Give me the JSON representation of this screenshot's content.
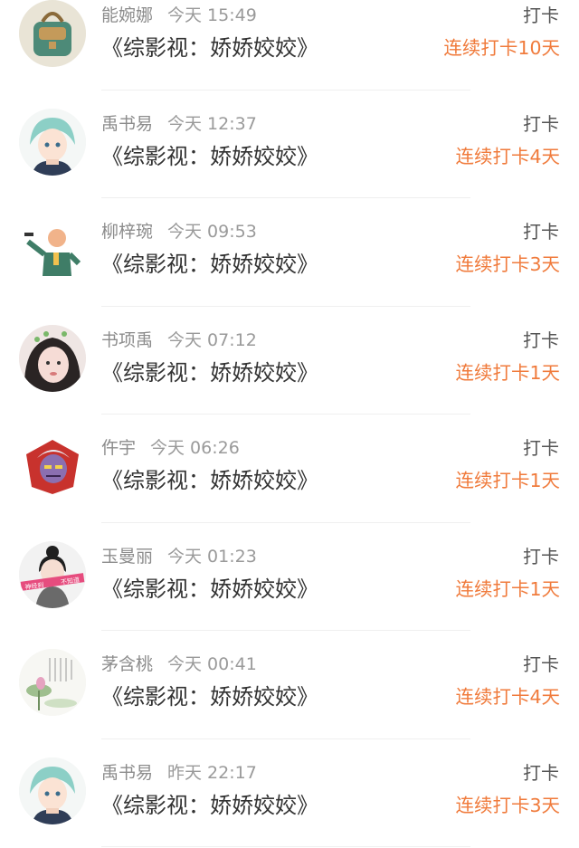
{
  "entries": [
    {
      "user": "能婉娜",
      "time": "今天 15:49",
      "book": "《综影视：娇娇姣姣》",
      "action": "打卡",
      "streak": "连续打卡10天",
      "avatar_icon": "backpack-avatar-icon",
      "avatar_color": "#5e8c6a"
    },
    {
      "user": "禹书易",
      "time": "今天 12:37",
      "book": "《综影视：娇娇姣姣》",
      "action": "打卡",
      "streak": "连续打卡4天",
      "avatar_icon": "anime-boy-avatar-icon",
      "avatar_color": "#7fb7b2"
    },
    {
      "user": "柳梓琬",
      "time": "今天 09:53",
      "book": "《综影视：娇娇姣姣》",
      "action": "打卡",
      "streak": "连续打卡3天",
      "avatar_icon": "cartoon-man-avatar-icon",
      "avatar_color": "#3f7d67"
    },
    {
      "user": "书项禹",
      "time": "今天 07:12",
      "book": "《综影视：娇娇姣姣》",
      "action": "打卡",
      "streak": "连续打卡1天",
      "avatar_icon": "girl-photo-avatar-icon",
      "avatar_color": "#d7a3a3"
    },
    {
      "user": "仵宇",
      "time": "今天 06:26",
      "book": "《综影视：娇娇姣姣》",
      "action": "打卡",
      "streak": "连续打卡1天",
      "avatar_icon": "red-badge-avatar-icon",
      "avatar_color": "#c8322d"
    },
    {
      "user": "玉曼丽",
      "time": "今天 01:23",
      "book": "《综影视：娇娇姣姣》",
      "action": "打卡",
      "streak": "连续打卡1天",
      "avatar_icon": "girl-bun-avatar-icon",
      "avatar_color": "#e64c7e",
      "avatar_text_left": "神经刹",
      "avatar_text_right": "不知道"
    },
    {
      "user": "茅含桃",
      "time": "今天 00:41",
      "book": "《综影视：娇娇姣姣》",
      "action": "打卡",
      "streak": "连续打卡4天",
      "avatar_icon": "lotus-painting-avatar-icon",
      "avatar_color": "#9fbf8f"
    },
    {
      "user": "禹书易",
      "time": "昨天 22:17",
      "book": "《综影视：娇娇姣姣》",
      "action": "打卡",
      "streak": "连续打卡3天",
      "avatar_icon": "anime-boy-avatar-icon",
      "avatar_color": "#7fb7b2"
    }
  ],
  "colors": {
    "streak": "#f07b3c",
    "name": "#8c8c8c",
    "title": "#333333"
  }
}
